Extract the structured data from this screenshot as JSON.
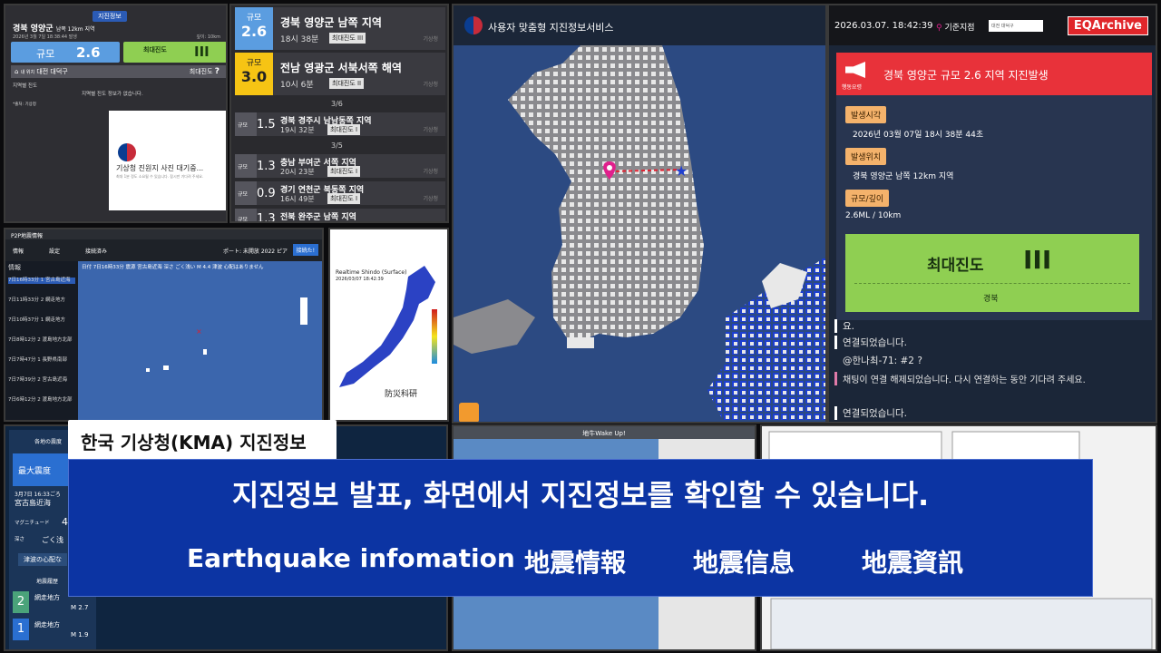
{
  "kma_panel": {
    "tag": "지진정보",
    "location": "경북 영양군",
    "location_detail": "남쪽 12km 지역",
    "issued": "2026년 3월 7일 18:38:44 발생",
    "depth": "깊이: 10km",
    "mag_label": "규모",
    "mag_value": "2.6",
    "int_label": "최대진도",
    "int_value": "III",
    "city_prefix": "내 위치",
    "city": "대전 대덕구",
    "city_right": "최대진도",
    "city_right_value": "?",
    "local_intensity": "지역별 진도",
    "no_info": "지역별 진도 정보가 없습니다.",
    "source": "*출처: 기상청",
    "card_title": "기상청 진원지 사진 대기중...",
    "card_sub": "최대 1분 정도 소요될 수 있습니다. 잠시만 기다려 주세요."
  },
  "quake_list": {
    "items": [
      {
        "label": "규모",
        "mag": "2.6",
        "title": "경북 영양군 남쪽 지역",
        "time": "18시 38분",
        "intensity": "최대진도 III",
        "source": "기상청",
        "color": "#5b9de0"
      },
      {
        "label": "규모",
        "mag": "3.0",
        "title": "전남 영광군 서북서쪽 해역",
        "time": "10시 6분",
        "intensity": "최대진도 II",
        "source": "기상청",
        "color": "#f6c414"
      }
    ],
    "date1": "3/6",
    "date2": "3/5",
    "old": [
      {
        "label": "규모",
        "mag": "1.5",
        "title": "경북 경주시 남남동쪽 지역",
        "time": "19시 32분",
        "intensity": "최대진도 I",
        "source": "기상청"
      },
      {
        "label": "규모",
        "mag": "1.3",
        "title": "충남 부여군 서쪽 지역",
        "time": "20시 23분",
        "intensity": "최대진도 I",
        "source": "기상청"
      },
      {
        "label": "규모",
        "mag": "0.9",
        "title": "경기 연천군 북동쪽 지역",
        "time": "16시 49분",
        "intensity": "최대진도 I",
        "source": "기상청"
      },
      {
        "label": "규모",
        "mag": "1.3",
        "title": "전북 완주군 남쪽 지역",
        "time": "",
        "intensity": "",
        "source": ""
      }
    ]
  },
  "map_panel": {
    "title": "사용자 맞춤형 지진정보서비스"
  },
  "info_panel": {
    "clock": "2026.03.07. 18:42:39",
    "ref_label": "기준지점",
    "ref_select": "대전 대덕구",
    "brand": "EQArchive",
    "alert_icon_label": "행동요령",
    "alert_title": "경북 영양군 규모 2.6 지역 지진발생",
    "time_label": "발생시각",
    "time_value": "2026년 03월 07일 18시 38분 44초",
    "place_label": "발생위치",
    "place_value": "경북 영양군 남쪽 12km 지역",
    "magdepth_label": "규모/깊이",
    "magdepth_value": "2.6ML / 10km",
    "int_title": "최대진도",
    "int_value": "III",
    "int_region": "경북",
    "chat": [
      "요.",
      "연결되었습니다.",
      "@한나최-71: #2 ?",
      "채팅이 연결 해제되었습니다. 다시 연결하는 동안 기다려 주세요.",
      "연결되었습니다."
    ]
  },
  "p2p_panel": {
    "title": "P2P地震情報",
    "tabs": [
      "情報",
      "設定",
      "接続済み"
    ],
    "port": "ポート: 未開放 2022 ピア",
    "btn": "接続た!",
    "list_head": "情報",
    "entries": [
      "7日16時33分 1 宮古島近海",
      "7日11時33分 2 網走地方",
      "7日10時37分 1 網走地方",
      "7日8時12分 2 渡島地方北部",
      "7日7時47分 1 長野県南部",
      "7日7時39分 2 宮古島近海",
      "7日6時12分 2 渡島地方北部"
    ],
    "header_text": "日付 7日16時33分 震源 宮古島近海 深さ ごく浅い M 4.4 津波 心配はありません"
  },
  "nied_panel": {
    "title": "Realtime Shindo (Surface)",
    "date": "2026/03/07 18:42:39",
    "brand": "防災科研"
  },
  "bottom_left": {
    "header": "各地の震度",
    "max_label": "最大震度",
    "date": "3月7日 16:33ごろ",
    "place": "宮古島近海",
    "mag_label": "マグニチュード",
    "mag": "4",
    "depth_label": "深さ",
    "depth": "ごく浅",
    "tsunami": "津波の心配な",
    "history": "地震履歴",
    "h1_place": "網走地方",
    "h1_m": "M 2.7",
    "h1_int": "2",
    "h2_place": "網走地方",
    "h2_m": "M 1.9",
    "h2_int": "1"
  },
  "bottom_mid": {
    "title": "地牛Wake Up!"
  },
  "overlay": {
    "tag": "한국 기상청(KMA) 지진정보",
    "main": "지진정보 발표, 화면에서 지진정보를 확인할 수 있습니다.",
    "sub": [
      "Earthquake infomation",
      "地震情報",
      "地震信息",
      "地震資訊"
    ]
  },
  "colors": {
    "blue_badge": "#5b9de0",
    "green_int": "#8fcf52",
    "alert_red": "#e8323a",
    "overlay_blue": "#0c34a3"
  }
}
